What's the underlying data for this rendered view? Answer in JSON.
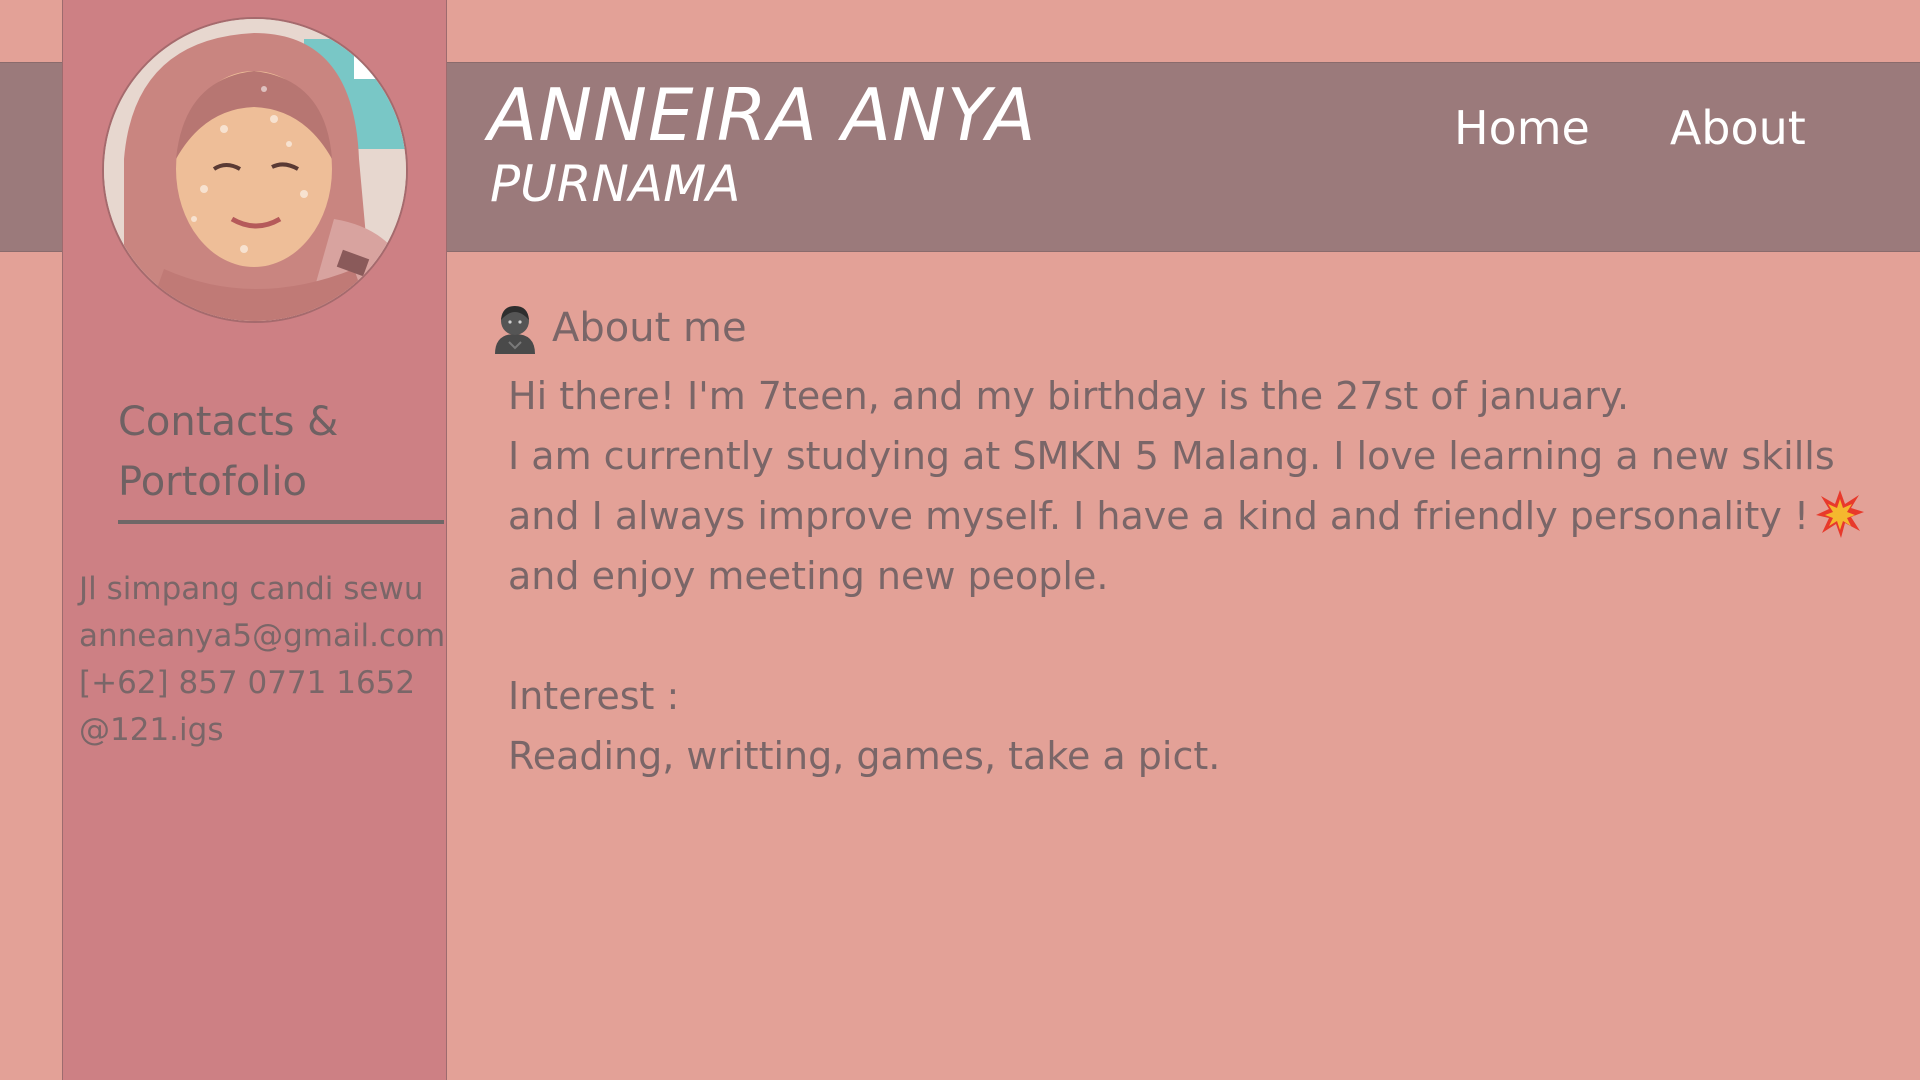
{
  "header": {
    "name_line1": "ANNEIRA ANYA",
    "name_line2": "PURNAMA",
    "nav": [
      "Home",
      "About"
    ]
  },
  "sidebar": {
    "avatar_icon": "profile-photo",
    "contacts_title_line1": "Contacts &",
    "contacts_title_line2": "Portofolio",
    "contacts": [
      "Jl simpang candi sewu",
      "anneanya5@gmail.com",
      "[+62] 857 0771 1652",
      "@121.igs"
    ]
  },
  "main": {
    "section_icon": "person-icon",
    "section_title": "About me",
    "paragraph_lines": [
      "Hi there! I'm 7teen, and my birthday is the 27st of january.",
      "I am currently studying at SMKN 5 Malang.  I love learning a new skills",
      "and I always improve myself. I have a kind and friendly personality !",
      "and enjoy meeting new people."
    ],
    "inline_icon": "collision-icon",
    "interest_label": "Interest :",
    "interest_value": "Reading, writting, games, take a pict."
  },
  "colors": {
    "background": "#e3a197",
    "header": "#9b7a7b",
    "sidebar": "#cd8084",
    "text": "#7a6668",
    "header_text": "#ffffff"
  }
}
